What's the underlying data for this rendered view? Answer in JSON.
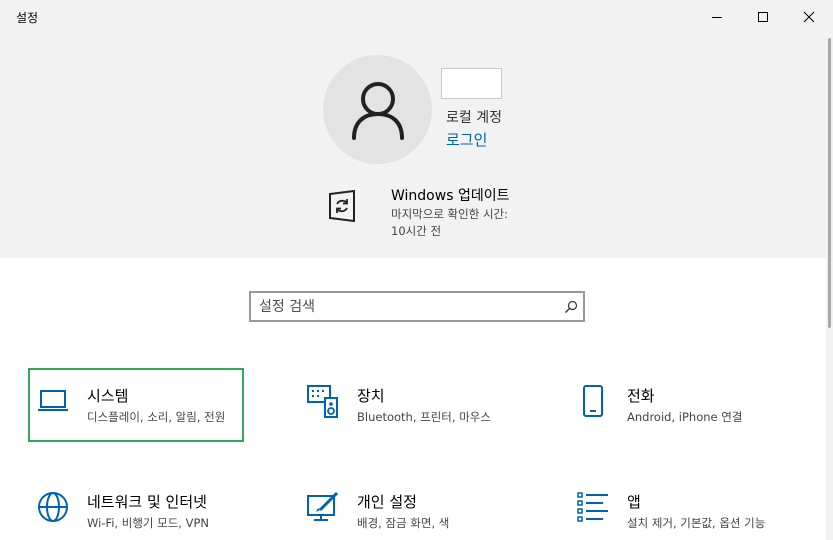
{
  "window": {
    "title": "설정",
    "controls": {
      "minimize": "minimize-icon",
      "maximize": "maximize-icon",
      "close": "close-icon"
    }
  },
  "account": {
    "type": "로컬 계정",
    "login_label": "로그인",
    "avatar_icon": "user-icon"
  },
  "update": {
    "title": "Windows 업데이트",
    "description": "마지막으로 확인한 시간: 10시간 전",
    "icon": "windows-update-icon"
  },
  "search": {
    "placeholder": "설정 검색",
    "icon": "search-icon"
  },
  "categories": [
    {
      "name": "시스템",
      "description": "디스플레이, 소리, 알림, 전원",
      "icon": "laptop-icon"
    },
    {
      "name": "장치",
      "description": "Bluetooth, 프린터, 마우스",
      "icon": "devices-icon"
    },
    {
      "name": "전화",
      "description": "Android, iPhone 연결",
      "icon": "phone-icon"
    },
    {
      "name": "네트워크 및 인터넷",
      "description": "Wi-Fi, 비행기 모드, VPN",
      "icon": "globe-icon"
    },
    {
      "name": "개인 설정",
      "description": "배경, 잠금 화면, 색",
      "icon": "personalization-icon"
    },
    {
      "name": "앱",
      "description": "설치 제거, 기본값, 옵션 기능",
      "icon": "apps-list-icon"
    }
  ],
  "colors": {
    "accent": "#0063b1",
    "selection": "#34a853",
    "header_bg": "#f2f2f2"
  }
}
